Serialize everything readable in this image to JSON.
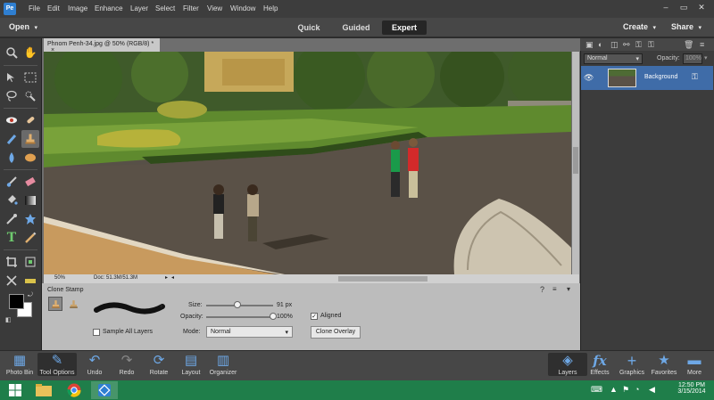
{
  "menu": [
    "File",
    "Edit",
    "Image",
    "Enhance",
    "Layer",
    "Select",
    "Filter",
    "View",
    "Window",
    "Help"
  ],
  "app_logo": "Pe",
  "modebar": {
    "open": "Open",
    "tabs": [
      "Quick",
      "Guided",
      "Expert"
    ],
    "create": "Create",
    "share": "Share"
  },
  "document": {
    "tab_title": "Phnom Penh-34.jpg @ 50% (RGB/8) *",
    "close": "×",
    "zoom": "50%",
    "doc_size": "Doc: 51.3M/51.3M"
  },
  "tool_options": {
    "title": "Clone Stamp",
    "size_label": "Size:",
    "size_value": "91 px",
    "size_level": 0.46,
    "opacity_label": "Opacity:",
    "opacity_value": "100%",
    "opacity_level": 1.0,
    "sample_all_layers": "Sample All Layers",
    "sample_all_checked": false,
    "mode_label": "Mode:",
    "mode_value": "Normal",
    "aligned_label": "Aligned",
    "aligned_checked": true,
    "clone_overlay": "Clone Overlay"
  },
  "layers": {
    "blend_mode": "Normal",
    "opacity_label": "Opacity:",
    "opacity_value": "100%",
    "layer_name": "Background"
  },
  "appbar": {
    "left": [
      {
        "icon": "photo-bin-icon",
        "label": "Photo Bin"
      },
      {
        "icon": "tool-options-icon",
        "label": "Tool Options"
      },
      {
        "icon": "undo-icon",
        "label": "Undo"
      },
      {
        "icon": "redo-icon",
        "label": "Redo"
      },
      {
        "icon": "rotate-icon",
        "label": "Rotate"
      },
      {
        "icon": "layout-icon",
        "label": "Layout"
      },
      {
        "icon": "organizer-icon",
        "label": "Organizer"
      }
    ],
    "right": [
      {
        "icon": "layers-icon",
        "label": "Layers"
      },
      {
        "icon": "effects-icon",
        "label": "Effects"
      },
      {
        "icon": "graphics-icon",
        "label": "Graphics"
      },
      {
        "icon": "favorites-icon",
        "label": "Favorites"
      },
      {
        "icon": "more-icon",
        "label": "More"
      }
    ]
  },
  "clock": {
    "time": "12:50 PM",
    "date": "3/15/2014"
  },
  "colors": {
    "accent_blue": "#3f6ca8",
    "taskbar_green": "#1f7e4a",
    "expert_tab": "#262626"
  }
}
